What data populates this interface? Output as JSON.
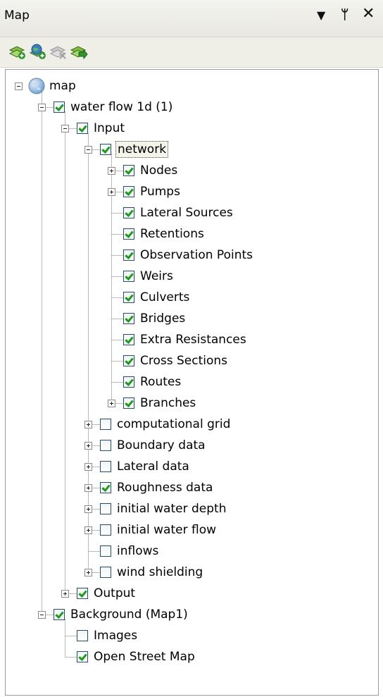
{
  "window": {
    "title": "Map",
    "dropdown_glyph": "▼",
    "pin_glyph": "ᛘ",
    "close_glyph": "✕"
  },
  "toolbar": {
    "tools": [
      {
        "icon": "add-layer-icon",
        "enabled": true
      },
      {
        "icon": "add-wms-layer-icon",
        "enabled": true
      },
      {
        "icon": "remove-layer-icon",
        "enabled": false
      },
      {
        "icon": "zoom-to-layer-icon",
        "enabled": true
      }
    ]
  },
  "tree": {
    "nodes": [
      {
        "label": "map",
        "depth": 0,
        "expander": "minus",
        "icon": "globe-icon"
      },
      {
        "label": "water flow 1d (1)",
        "depth": 1,
        "expander": "minus",
        "checked": true
      },
      {
        "label": "Input",
        "depth": 2,
        "expander": "minus",
        "checked": true
      },
      {
        "label": "network",
        "depth": 3,
        "expander": "minus",
        "checked": true,
        "selected": true
      },
      {
        "label": "Nodes",
        "depth": 4,
        "expander": "plus",
        "checked": true
      },
      {
        "label": "Pumps",
        "depth": 4,
        "expander": "plus",
        "checked": true
      },
      {
        "label": "Lateral Sources",
        "depth": 4,
        "expander": "none",
        "checked": true
      },
      {
        "label": "Retentions",
        "depth": 4,
        "expander": "none",
        "checked": true
      },
      {
        "label": "Observation Points",
        "depth": 4,
        "expander": "none",
        "checked": true
      },
      {
        "label": "Weirs",
        "depth": 4,
        "expander": "none",
        "checked": true
      },
      {
        "label": "Culverts",
        "depth": 4,
        "expander": "none",
        "checked": true
      },
      {
        "label": "Bridges",
        "depth": 4,
        "expander": "none",
        "checked": true
      },
      {
        "label": "Extra Resistances",
        "depth": 4,
        "expander": "none",
        "checked": true
      },
      {
        "label": "Cross Sections",
        "depth": 4,
        "expander": "none",
        "checked": true
      },
      {
        "label": "Routes",
        "depth": 4,
        "expander": "none",
        "checked": true
      },
      {
        "label": "Branches",
        "depth": 4,
        "expander": "plus",
        "checked": true
      },
      {
        "label": "computational grid",
        "depth": 3,
        "expander": "plus",
        "checked": false
      },
      {
        "label": "Boundary data",
        "depth": 3,
        "expander": "plus",
        "checked": false
      },
      {
        "label": "Lateral data",
        "depth": 3,
        "expander": "plus",
        "checked": false
      },
      {
        "label": "Roughness data",
        "depth": 3,
        "expander": "plus",
        "checked": true
      },
      {
        "label": "initial water depth",
        "depth": 3,
        "expander": "plus",
        "checked": false
      },
      {
        "label": "initial water flow",
        "depth": 3,
        "expander": "plus",
        "checked": false
      },
      {
        "label": "inflows",
        "depth": 3,
        "expander": "none",
        "checked": false
      },
      {
        "label": "wind shielding",
        "depth": 3,
        "expander": "plus",
        "checked": false
      },
      {
        "label": "Output",
        "depth": 2,
        "expander": "plus",
        "checked": true
      },
      {
        "label": "Background (Map1)",
        "depth": 1,
        "expander": "minus",
        "checked": true
      },
      {
        "label": "Images",
        "depth": 2,
        "expander": "none",
        "checked": false
      },
      {
        "label": "Open Street Map",
        "depth": 2,
        "expander": "none",
        "checked": true
      }
    ]
  }
}
